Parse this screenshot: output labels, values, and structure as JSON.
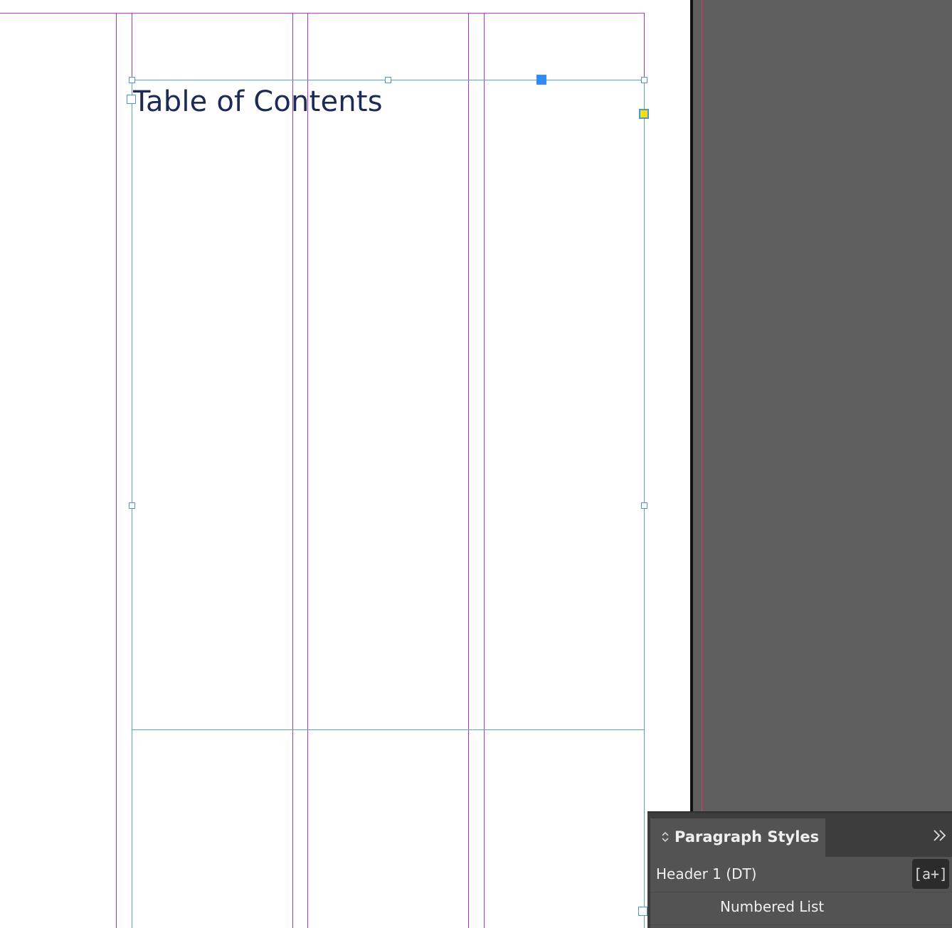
{
  "document": {
    "title_text": "Table of Contents"
  },
  "paragraph_styles_panel": {
    "tab_label": "Paragraph Styles",
    "tab_arrows_icon": "updown-arrows-icon",
    "collapse_icon": "double-chevron-right-icon",
    "collapse_glyph": "»",
    "styles": [
      {
        "label": "Header 1 (DT)",
        "selected": true
      },
      {
        "label": "Numbered List",
        "selected": false
      }
    ],
    "new_style_button_glyph": "[a+]"
  },
  "colors": {
    "pasteboard": "#5f5f5f",
    "guide_margin": "#c23cc9",
    "frame_selection": "#5ba3cf",
    "title_text": "#1d2a55",
    "panel_bg": "#535353"
  }
}
